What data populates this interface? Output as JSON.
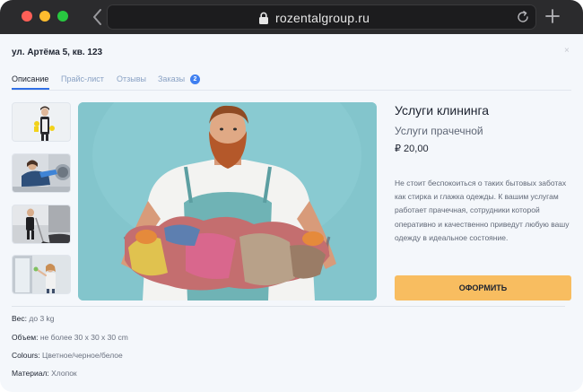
{
  "browser": {
    "url": "rozentalgroup.ru"
  },
  "page": {
    "address_title": "ул. Артёма 5, кв. 123",
    "close_glyph": "×"
  },
  "tabs": [
    {
      "label": "Описание",
      "active": true
    },
    {
      "label": "Прайс-лист",
      "active": false
    },
    {
      "label": "Отзывы",
      "active": false
    },
    {
      "label": "Заказы",
      "active": false,
      "badge": "2"
    }
  ],
  "gallery": {
    "thumbnails": [
      "cleaner-with-gloves",
      "washing-machine",
      "mopping-floor",
      "cleaning-window"
    ],
    "main_image": "man-holding-laundry-basket"
  },
  "product": {
    "title": "Услуги клининга",
    "subtitle": "Услуги прачечной",
    "price": "₽ 20,00",
    "description": "Не стоит беспокоиться о таких бытовых заботах как стирка и глажка одежды. К вашим услугам работает прачечная, сотрудники которой оперативно и качественно приведут любую вашу одежду в идеальное состояние.",
    "order_label": "ОФОРМИТЬ"
  },
  "specs": [
    {
      "key": "Вес:",
      "value": "до 3 kg"
    },
    {
      "key": "Объем:",
      "value": "не более 30 x 30 x 30 cm"
    },
    {
      "key": "Colours:",
      "value": "Цветное/черное/белое"
    },
    {
      "key": "Материал:",
      "value": "Хлопок"
    }
  ],
  "colors": {
    "accent": "#2f6fe6",
    "order_button": "#f8bd60",
    "background": "#f4f7fb"
  }
}
